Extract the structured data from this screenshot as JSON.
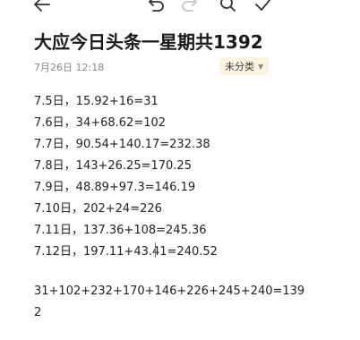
{
  "toolbar": {
    "back_icon": "arrow-left-icon",
    "undo_icon": "undo-icon",
    "redo_icon": "redo-icon",
    "search_icon": "search-icon",
    "confirm_icon": "check-icon"
  },
  "note": {
    "title": "大应今日头条一星期共1392",
    "time": "7月26日 12:18",
    "category": "未分类",
    "lines": [
      "7.5日，15.92+16=31",
      "7.6日，34+68.62=102",
      "7.7日，90.54+140.17=232.38",
      "7.8日，143+26.25=170.25",
      "7.9日，48.89+97.3=146.19",
      "7.10日，202+24=226",
      "7.11日，137.36+108=245.36",
      "7.12日，197.11+43.41=240.52",
      "",
      "31+102+232+170+146+226+245+240=139",
      "2"
    ]
  }
}
